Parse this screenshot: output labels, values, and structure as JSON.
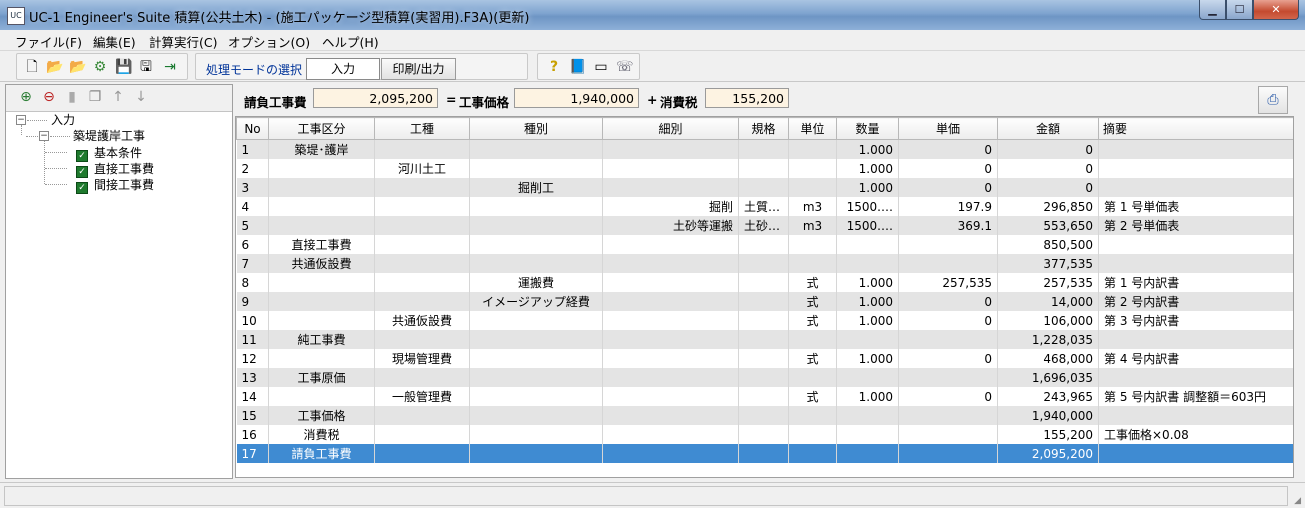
{
  "window": {
    "icon_text": "UC",
    "title": "UC-1 Engineer's Suite 積算(公共土木) - (施工パッケージ型積算(実習用).F3A)(更新)",
    "buttons": {
      "minimize": "▁",
      "maximize": "☐",
      "close": "✕"
    }
  },
  "menu": [
    "ファイル(F)",
    "編集(E)",
    "計算実行(C)",
    "オプション(O)",
    "ヘルプ(H)"
  ],
  "toolbar": {
    "icons": [
      "new-file-icon",
      "open-folder-icon",
      "open-recent-icon",
      "settings-icon",
      "save-icon",
      "save-as-icon",
      "exit-icon"
    ],
    "mode_label": "処理モードの選択",
    "mode_input": "入力",
    "mode_print": "印刷/出力",
    "help_icons": [
      "help-icon",
      "manual-icon",
      "about-icon",
      "support-icon"
    ]
  },
  "left_toolbar": {
    "icons": [
      "add-node-icon",
      "delete-node-icon",
      "disabled-icon",
      "copy-node-icon",
      "up-arrow-icon",
      "down-arrow-icon"
    ]
  },
  "tree": {
    "root": "入力",
    "child": "築堤護岸工事",
    "leaves": [
      "基本条件",
      "直接工事費",
      "間接工事費"
    ]
  },
  "summary": {
    "label1": "請負工事費",
    "value1": "2,095,200",
    "eq": "=",
    "label2": "工事価格",
    "value2": "1,940,000",
    "plus": "+",
    "label3": "消費税",
    "value3": "155,200"
  },
  "grid": {
    "headers": [
      "No",
      "工事区分",
      "工種",
      "種別",
      "細別",
      "規格",
      "単位",
      "数量",
      "単価",
      "金額",
      "摘要"
    ],
    "rows": [
      [
        "1",
        "築堤･護岸",
        "",
        "",
        "",
        "",
        "",
        "1.000",
        "0",
        "0",
        ""
      ],
      [
        "2",
        "",
        "河川土工",
        "",
        "",
        "",
        "",
        "1.000",
        "0",
        "0",
        ""
      ],
      [
        "3",
        "",
        "",
        "掘削工",
        "",
        "",
        "",
        "1.000",
        "0",
        "0",
        ""
      ],
      [
        "4",
        "",
        "",
        "",
        "掘削",
        "土質…",
        "m3",
        "1500.…",
        "197.9",
        "296,850",
        "第 1 号単価表"
      ],
      [
        "5",
        "",
        "",
        "",
        "土砂等運搬",
        "土砂…",
        "m3",
        "1500.…",
        "369.1",
        "553,650",
        "第 2 号単価表"
      ],
      [
        "6",
        "直接工事費",
        "",
        "",
        "",
        "",
        "",
        "",
        "",
        "850,500",
        ""
      ],
      [
        "7",
        "共通仮設費",
        "",
        "",
        "",
        "",
        "",
        "",
        "",
        "377,535",
        ""
      ],
      [
        "8",
        "",
        "",
        "運搬費",
        "",
        "",
        "式",
        "1.000",
        "257,535",
        "257,535",
        "第 1 号内訳書"
      ],
      [
        "9",
        "",
        "",
        "イメージアップ経費",
        "",
        "",
        "式",
        "1.000",
        "0",
        "14,000",
        "第 2 号内訳書"
      ],
      [
        "10",
        "",
        "共通仮設費",
        "",
        "",
        "",
        "式",
        "1.000",
        "0",
        "106,000",
        "第 3 号内訳書"
      ],
      [
        "11",
        "純工事費",
        "",
        "",
        "",
        "",
        "",
        "",
        "",
        "1,228,035",
        ""
      ],
      [
        "12",
        "",
        "現場管理費",
        "",
        "",
        "",
        "式",
        "1.000",
        "0",
        "468,000",
        "第 4 号内訳書"
      ],
      [
        "13",
        "工事原価",
        "",
        "",
        "",
        "",
        "",
        "",
        "",
        "1,696,035",
        ""
      ],
      [
        "14",
        "",
        "一般管理費",
        "",
        "",
        "",
        "式",
        "1.000",
        "0",
        "243,965",
        "第 5 号内訳書 調整額＝603円"
      ],
      [
        "15",
        "工事価格",
        "",
        "",
        "",
        "",
        "",
        "",
        "",
        "1,940,000",
        ""
      ],
      [
        "16",
        "消費税",
        "",
        "",
        "",
        "",
        "",
        "",
        "",
        "155,200",
        "工事価格×0.08"
      ],
      [
        "17",
        "請負工事費",
        "",
        "",
        "",
        "",
        "",
        "",
        "",
        "2,095,200",
        ""
      ]
    ],
    "selected_row": 17
  },
  "colors": {
    "selection": "#3f8bd2",
    "sum_field": "#fdf3e2",
    "mode_label": "#003399"
  }
}
